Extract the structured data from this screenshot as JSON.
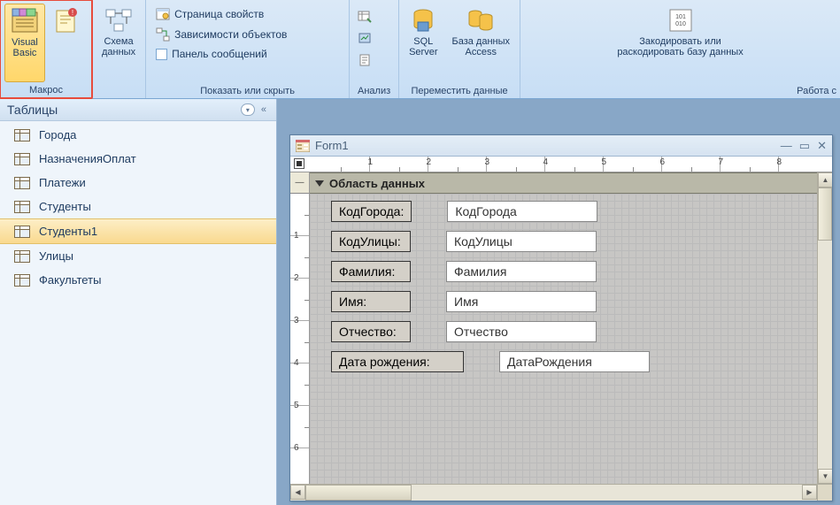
{
  "ribbon": {
    "groups": {
      "macros": {
        "label": "Макрос",
        "visual_basic": "Visual\nBasic"
      },
      "schema": {
        "label": "Схема\nданных"
      },
      "show_hide": {
        "label": "Показать или скрыть",
        "page_props": "Страница свойств",
        "dependencies": "Зависимости объектов",
        "msg_panel": "Панель сообщений"
      },
      "analyze": {
        "label": "Анализ"
      },
      "move_data": {
        "label": "Переместить данные",
        "sql_server": "SQL\nServer",
        "access_db": "База данных\nAccess"
      },
      "tools": {
        "label": "Работа с",
        "encode": "Закодировать или\nраскодировать базу данных"
      }
    }
  },
  "nav": {
    "title": "Таблицы",
    "items": [
      {
        "label": "Города"
      },
      {
        "label": "НазначенияОплат"
      },
      {
        "label": "Платежи"
      },
      {
        "label": "Студенты"
      },
      {
        "label": "Студенты1"
      },
      {
        "label": "Улицы"
      },
      {
        "label": "Факультеты"
      }
    ],
    "selected_index": 4
  },
  "form": {
    "title": "Form1",
    "section": "Область данных",
    "fields": [
      {
        "label": "КодГорода:",
        "value": "КодГорода",
        "wide": false
      },
      {
        "label": "КодУлицы:",
        "value": "КодУлицы",
        "wide": false
      },
      {
        "label": "Фамилия:",
        "value": "Фамилия",
        "wide": false
      },
      {
        "label": "Имя:",
        "value": "Имя",
        "wide": false
      },
      {
        "label": "Отчество:",
        "value": "Отчество",
        "wide": false
      },
      {
        "label": "Дата рождения:",
        "value": "ДатаРождения",
        "wide": true
      }
    ],
    "hruler": [
      "1",
      "2",
      "3",
      "4",
      "5",
      "6",
      "7",
      "8"
    ],
    "vruler": [
      "1",
      "2",
      "3",
      "4",
      "5",
      "6"
    ]
  }
}
